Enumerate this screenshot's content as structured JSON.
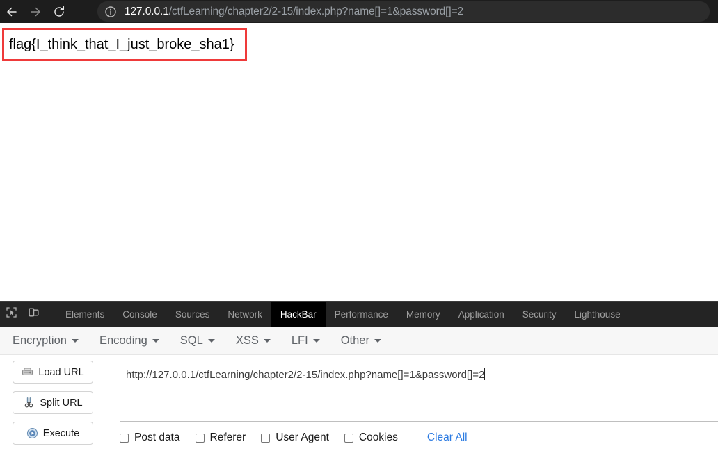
{
  "browser": {
    "nav": {
      "back_icon": "arrow-left-icon",
      "forward_icon": "arrow-right-icon",
      "reload_icon": "reload-icon"
    },
    "omnibox": {
      "security_icon": "info-circle-icon",
      "url_host": "127.0.0.1",
      "url_path": "/ctfLearning/chapter2/2-15/index.php?name[]=1&password[]=2",
      "url_full": "127.0.0.1/ctfLearning/chapter2/2-15/index.php?name[]=1&password[]=2"
    }
  },
  "page": {
    "flag": "flag{I_think_that_I_just_broke_sha1}",
    "highlight_color": "#ef3a3a"
  },
  "devtools": {
    "inspect_icon": "inspect-element-icon",
    "device_icon": "device-toolbar-icon",
    "tabs": [
      {
        "label": "Elements",
        "active": false
      },
      {
        "label": "Console",
        "active": false
      },
      {
        "label": "Sources",
        "active": false
      },
      {
        "label": "Network",
        "active": false
      },
      {
        "label": "HackBar",
        "active": true
      },
      {
        "label": "Performance",
        "active": false
      },
      {
        "label": "Memory",
        "active": false
      },
      {
        "label": "Application",
        "active": false
      },
      {
        "label": "Security",
        "active": false
      },
      {
        "label": "Lighthouse",
        "active": false
      }
    ]
  },
  "hackbar": {
    "menu": [
      {
        "label": "Encryption"
      },
      {
        "label": "Encoding"
      },
      {
        "label": "SQL"
      },
      {
        "label": "XSS"
      },
      {
        "label": "LFI"
      },
      {
        "label": "Other"
      }
    ],
    "buttons": [
      {
        "label": "Load URL",
        "icon": "disk-drive-icon"
      },
      {
        "label": "Split URL",
        "icon": "scissors-icon"
      },
      {
        "label": "Execute",
        "icon": "play-circle-icon"
      }
    ],
    "url_field": {
      "value": "http://127.0.0.1/ctfLearning/chapter2/2-15/index.php?name[]=1&password[]=2",
      "placeholder": "http://"
    },
    "options": [
      {
        "label": "Post data",
        "checked": false
      },
      {
        "label": "Referer",
        "checked": false
      },
      {
        "label": "User Agent",
        "checked": false
      },
      {
        "label": "Cookies",
        "checked": false
      }
    ],
    "clear_all_label": "Clear All",
    "link_color": "#2a7ae2"
  }
}
